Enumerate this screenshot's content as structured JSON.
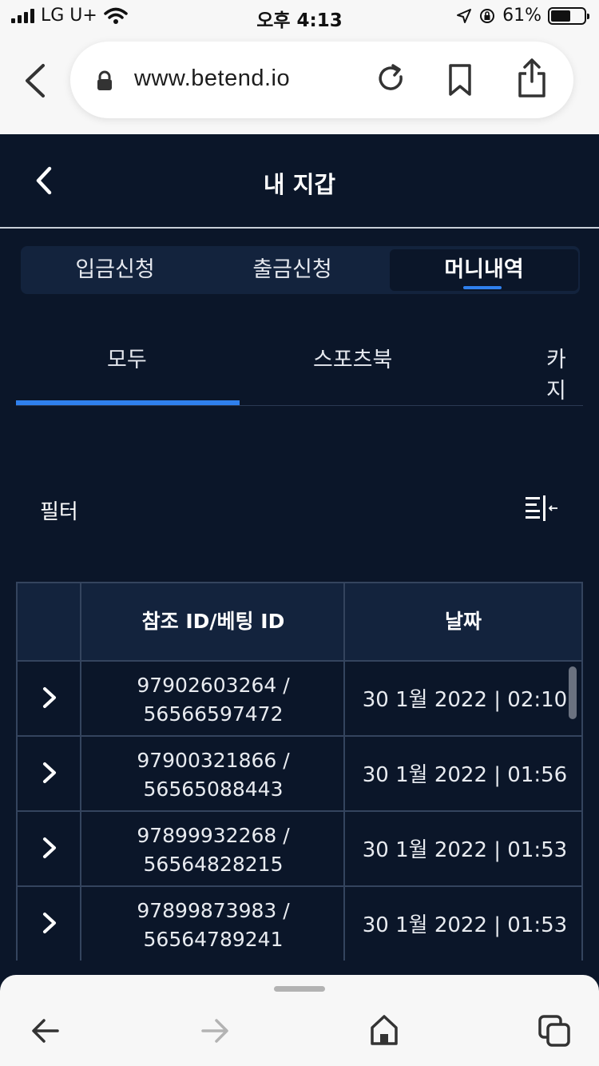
{
  "status_bar": {
    "carrier": "LG U+",
    "time": "오후 4:13",
    "battery": "61%",
    "battery_level": 0.61
  },
  "browser": {
    "url": "www.betend.io"
  },
  "header": {
    "title": "내 지갑"
  },
  "top_tabs": [
    {
      "label": "입금신청"
    },
    {
      "label": "출금신청"
    },
    {
      "label": "머니내역",
      "active": true
    }
  ],
  "sub_tabs": [
    {
      "label": "모두",
      "active": true
    },
    {
      "label": "스포츠북"
    },
    {
      "label": "카지"
    }
  ],
  "filter": {
    "label": "필터"
  },
  "table": {
    "columns": [
      "",
      "참조 ID/베팅 ID",
      "날짜"
    ],
    "rows": [
      {
        "ref_id": "97902603264 /",
        "bet_id": "56566597472",
        "date": "30 1월 2022 | 02:10"
      },
      {
        "ref_id": "97900321866 /",
        "bet_id": "56565088443",
        "date": "30 1월 2022 | 01:56"
      },
      {
        "ref_id": "97899932268 /",
        "bet_id": "56564828215",
        "date": "30 1월 2022 | 01:53"
      },
      {
        "ref_id": "97899873983 /",
        "bet_id": "56564789241",
        "date": "30 1월 2022 | 01:53"
      }
    ]
  },
  "colors": {
    "background": "#0b1629",
    "panel": "#13233d",
    "accent": "#2f80ed",
    "border": "#34445e"
  }
}
